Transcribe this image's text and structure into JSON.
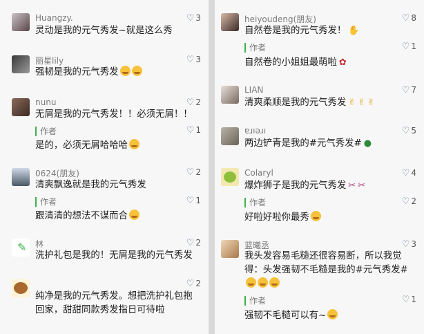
{
  "left": [
    {
      "user": "Huangzy.",
      "likes": "3",
      "text": "灵动是我的元气秀发~就是这么秀"
    },
    {
      "user": "丽星lily",
      "likes": "3",
      "text": "强韧是我的元气秀发"
    },
    {
      "user": "nunu",
      "likes": "2",
      "text": "无屑是我的元气秀发！！必须无屑！！",
      "reply": {
        "author": "作者",
        "likes": "1",
        "text": "是的，必须无屑哈哈哈"
      }
    },
    {
      "user": "0624(朋友)",
      "likes": "2",
      "text": "清爽飘逸就是我的元气秀发",
      "reply": {
        "author": "作者",
        "likes": "1",
        "text": "跟清清的想法不谋而合"
      }
    },
    {
      "user": "林",
      "likes": "2",
      "text": "洗护礼包是我的！无屑是我的元气秀发"
    },
    {
      "user": "",
      "likes": "2",
      "text": "纯净是我的元气秀发。想把洗护礼包抱回家，甜甜同款秀发指日可待啦"
    }
  ],
  "right": [
    {
      "user": "heiyoudeng(朋友)",
      "likes": "8",
      "text": "自然卷是我的元气秀发！",
      "reply": {
        "author": "作者",
        "likes": "1",
        "text": "自然卷的小姐姐最萌啦"
      }
    },
    {
      "user": "LIAN",
      "likes": "7",
      "text": "清爽柔顺是我的元气秀发"
    },
    {
      "user": "ɐɹıǝɹı",
      "likes": "5",
      "text": "两边铲青是我的#元气秀发#"
    },
    {
      "user": "Colaryl",
      "likes": "4",
      "text": "爆炸狮子是我的元气秀发",
      "reply": {
        "author": "作者",
        "likes": "2",
        "text": "好啦好啦你最秀"
      }
    },
    {
      "user": "蓝曦丞",
      "likes": "3",
      "text": "我头发容易毛糙还很容易断，所以我觉得：头发强韧不毛糙是我的#元气秀发#",
      "reply": {
        "author": "作者",
        "likes": "1",
        "text": "强韧不毛糙可以有~"
      }
    }
  ],
  "icons": {
    "like": "heart-outline-icon",
    "author_marker": "green-bar"
  },
  "colors": {
    "like": "#576b95",
    "author_bar": "#3cb24a",
    "background": "#f7f7f7"
  }
}
